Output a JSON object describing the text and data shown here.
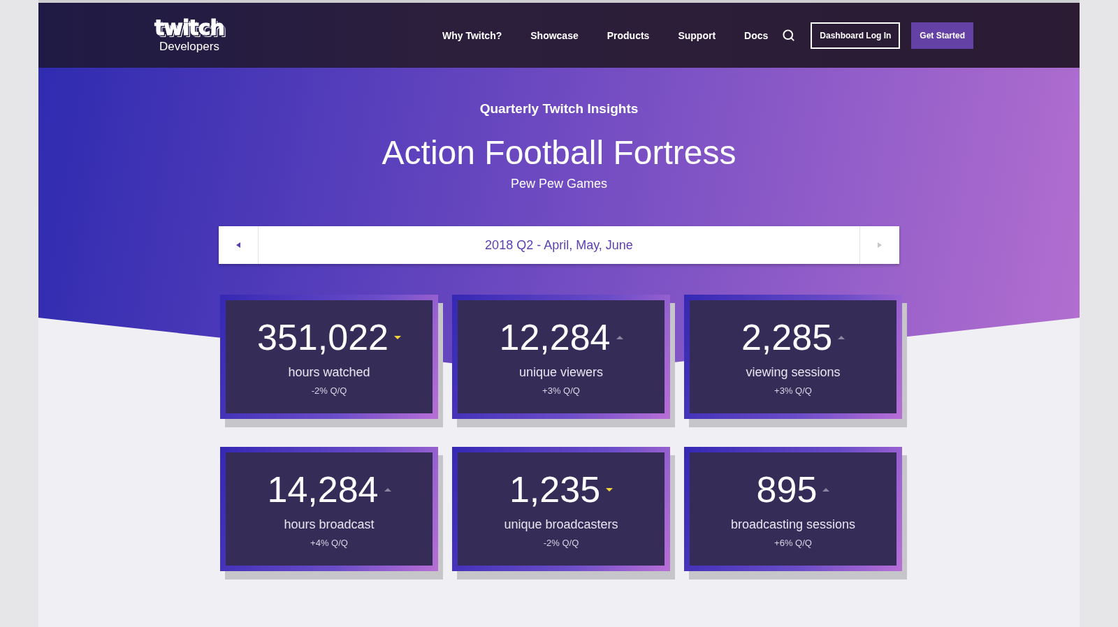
{
  "header": {
    "logo": "twitch",
    "logo_sub": "Developers",
    "nav": [
      "Why Twitch?",
      "Showcase",
      "Products",
      "Support",
      "Docs"
    ],
    "login_button": "Dashboard Log In",
    "cta_button": "Get Started"
  },
  "hero": {
    "eyebrow": "Quarterly Twitch Insights",
    "title": "Action Football Fortress",
    "subtitle": "Pew Pew Games"
  },
  "period": {
    "label": "2018 Q2 - April, May, June"
  },
  "stats": [
    {
      "value": "351,022",
      "label": "hours watched",
      "change": "-2% Q/Q",
      "kind": "down"
    },
    {
      "value": "12,284",
      "label": "unique viewers",
      "change": "+3% Q/Q",
      "kind": "up"
    },
    {
      "value": "2,285",
      "label": "viewing sessions",
      "change": "+3% Q/Q",
      "kind": "up"
    },
    {
      "value": "14,284",
      "label": "hours broadcast",
      "change": "+4% Q/Q",
      "kind": "up"
    },
    {
      "value": "1,235",
      "label": "unique broadcasters",
      "change": "-2% Q/Q",
      "kind": "down"
    },
    {
      "value": "895",
      "label": "broadcasting sessions",
      "change": "+6% Q/Q",
      "kind": "up"
    }
  ]
}
